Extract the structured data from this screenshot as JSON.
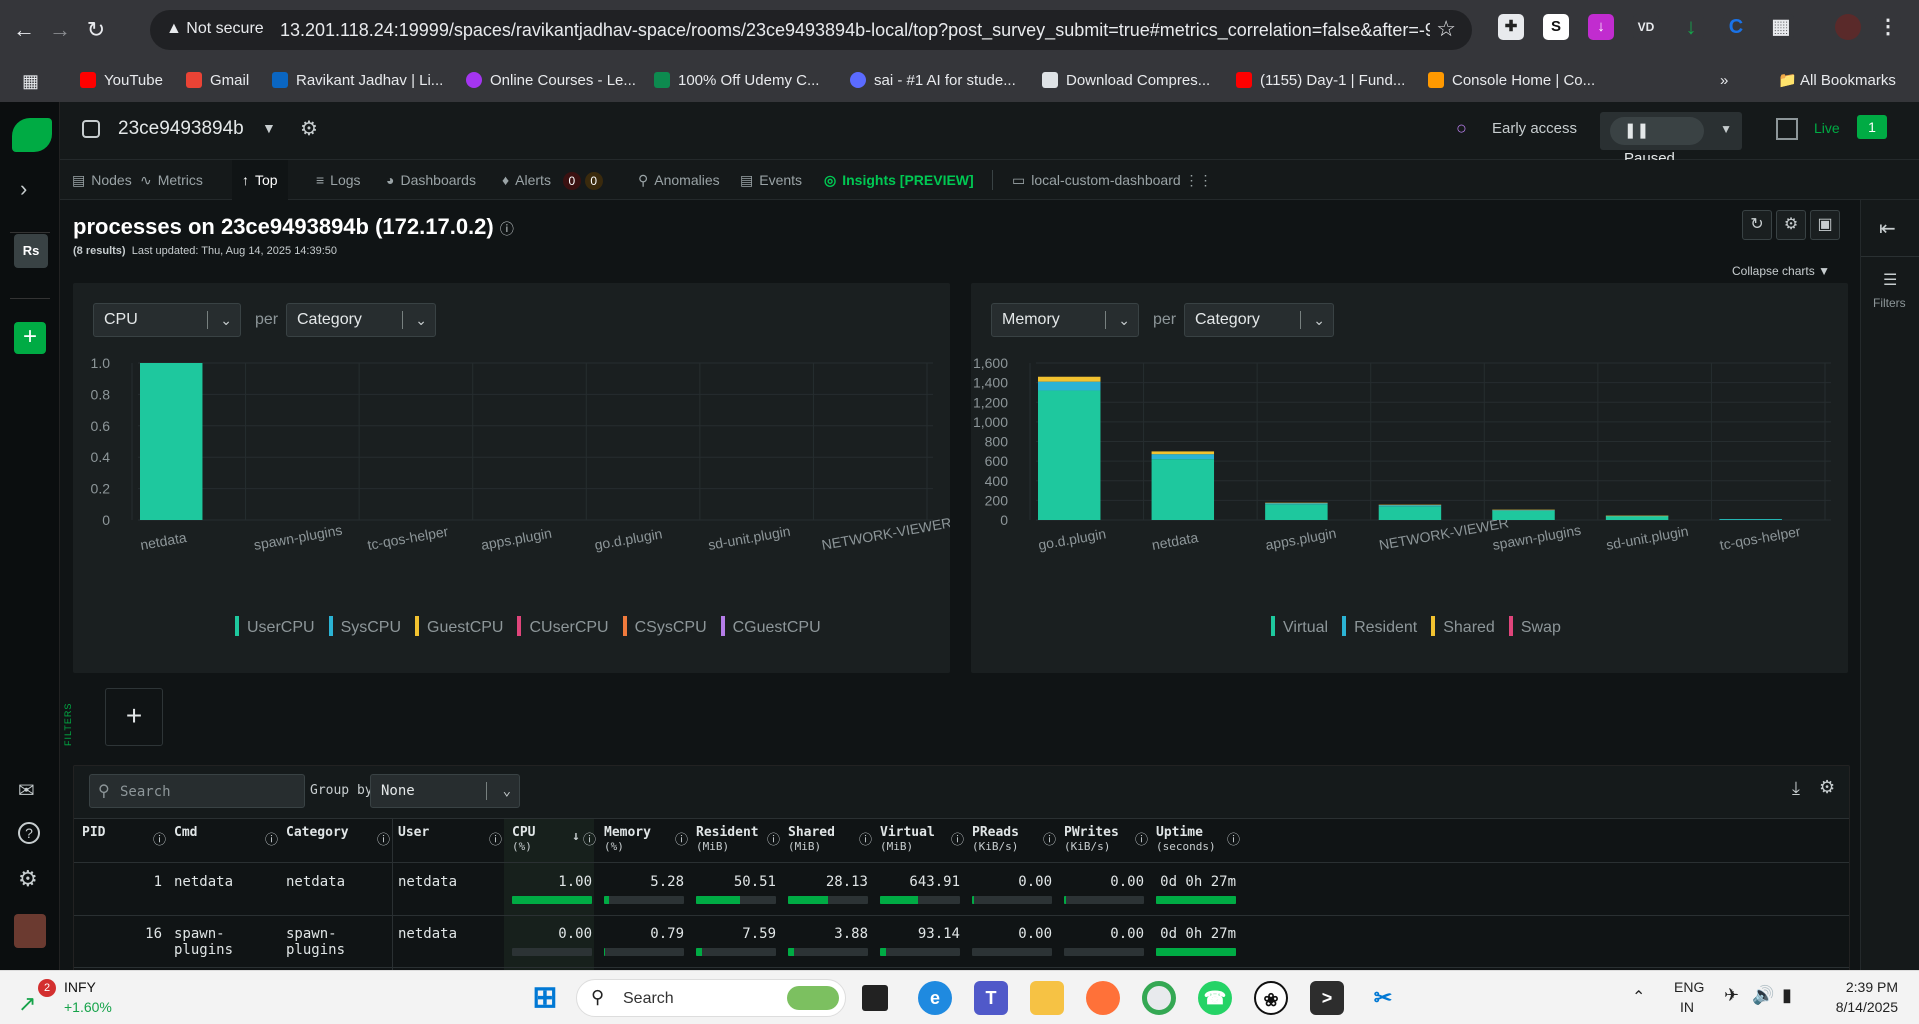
{
  "browser": {
    "not_secure": "Not secure",
    "url": "13.201.118.24:19999/spaces/ravikantjadhav-space/rooms/23ce9493894b-local/top?post_survey_submit=true#metrics_correlation=false&after=-90...",
    "bookmarks": [
      "YouTube",
      "Gmail",
      "Ravikant Jadhav | Li...",
      "Online Courses - Le...",
      "100% Off Udemy C...",
      "sai - #1 AI for stude...",
      "Download Compres...",
      "(1155) Day-1 | Fund...",
      "Console Home | Co..."
    ],
    "all_bookmarks": "All Bookmarks",
    "ext_letters": [
      "S",
      "VD"
    ]
  },
  "app": {
    "room_name": "23ce9493894b",
    "early_access": "Early access",
    "paused": "Paused",
    "live": "Live",
    "live_count": "1",
    "rail_badge": "Rs",
    "tabs": [
      "Nodes",
      "Metrics",
      "Top",
      "Logs",
      "Dashboards",
      "Alerts",
      "Anomalies",
      "Events",
      "Insights [PREVIEW]",
      "local-custom-dashboard"
    ],
    "alert_counts": [
      "0",
      "0"
    ],
    "filters_label": "Filters",
    "filters_side": "FILTERS"
  },
  "header": {
    "title": "processes on 23ce9493894b (172.17.0.2)",
    "results": "(8 results)",
    "updated": "Last updated: Thu, Aug 14, 2025 14:39:50",
    "collapse": "Collapse charts"
  },
  "cpu_panel": {
    "metric": "CPU",
    "per": "per",
    "group": "Category"
  },
  "mem_panel": {
    "metric": "Memory",
    "per": "per",
    "group": "Category"
  },
  "chart_data": [
    {
      "type": "bar",
      "categories": [
        "netdata",
        "spawn-plugins",
        "tc-qos-helper",
        "apps.plugin",
        "go.d.plugin",
        "sd-unit.plugin",
        "NETWORK-VIEWER"
      ],
      "series": [
        {
          "name": "UserCPU",
          "values": [
            1.0,
            0,
            0,
            0,
            0,
            0,
            0
          ]
        },
        {
          "name": "SysCPU",
          "values": [
            0,
            0,
            0,
            0,
            0,
            0,
            0
          ]
        },
        {
          "name": "GuestCPU",
          "values": [
            0,
            0,
            0,
            0,
            0,
            0,
            0
          ]
        },
        {
          "name": "CUserCPU",
          "values": [
            0,
            0,
            0,
            0,
            0,
            0,
            0
          ]
        },
        {
          "name": "CSysCPU",
          "values": [
            0,
            0,
            0,
            0,
            0,
            0,
            0
          ]
        },
        {
          "name": "CGuestCPU",
          "values": [
            0,
            0,
            0,
            0,
            0,
            0,
            0
          ]
        }
      ],
      "colors": [
        "#1ec89e",
        "#2bb3d4",
        "#f2c230",
        "#e0457b",
        "#f07a3c",
        "#b57de8"
      ],
      "ylim": [
        0,
        1.0
      ],
      "yticks": [
        "0",
        "0.2",
        "0.4",
        "0.6",
        "0.8",
        "1.0"
      ]
    },
    {
      "type": "bar",
      "categories": [
        "go.d.plugin",
        "netdata",
        "apps.plugin",
        "NETWORK-VIEWER",
        "spawn-plugins",
        "sd-unit.plugin",
        "tc-qos-helper"
      ],
      "series": [
        {
          "name": "Virtual",
          "values": [
            1320,
            620,
            160,
            140,
            95,
            40,
            8
          ]
        },
        {
          "name": "Resident",
          "values": [
            90,
            51,
            12,
            12,
            8,
            3,
            1
          ]
        },
        {
          "name": "Shared",
          "values": [
            50,
            28,
            4,
            4,
            2,
            1,
            0
          ]
        },
        {
          "name": "Swap",
          "values": [
            0,
            0,
            0,
            0,
            0,
            0,
            0
          ]
        }
      ],
      "colors": [
        "#1ec89e",
        "#2bb3d4",
        "#f2c230",
        "#e0457b"
      ],
      "ylim": [
        0,
        1600
      ],
      "yticks": [
        "0",
        "200",
        "400",
        "600",
        "800",
        "1,000",
        "1,200",
        "1,400",
        "1,600"
      ]
    }
  ],
  "table": {
    "search_placeholder": "Search",
    "group_by": "Group by",
    "group_value": "None",
    "columns": [
      {
        "name": "PID",
        "sub": ""
      },
      {
        "name": "Cmd",
        "sub": ""
      },
      {
        "name": "Category",
        "sub": ""
      },
      {
        "name": "User",
        "sub": ""
      },
      {
        "name": "CPU",
        "sub": "(%)"
      },
      {
        "name": "Memory",
        "sub": "(%)"
      },
      {
        "name": "Resident",
        "sub": "(MiB)"
      },
      {
        "name": "Shared",
        "sub": "(MiB)"
      },
      {
        "name": "Virtual",
        "sub": "(MiB)"
      },
      {
        "name": "PReads",
        "sub": "(KiB/s)"
      },
      {
        "name": "PWrites",
        "sub": "(KiB/s)"
      },
      {
        "name": "Uptime",
        "sub": "(seconds)"
      }
    ],
    "rows": [
      {
        "pid": "1",
        "cmd": "netdata",
        "category": "netdata",
        "user": "netdata",
        "cpu": "1.00",
        "memory": "5.28",
        "resident": "50.51",
        "shared": "28.13",
        "virtual": "643.91",
        "preads": "0.00",
        "pwrites": "0.00",
        "uptime": "0d 0h 27m",
        "bars": [
          1.0,
          0.06,
          0.55,
          0.5,
          0.48,
          0.02,
          0.02,
          1.0
        ]
      },
      {
        "pid": "16",
        "cmd": "spawn-plugins",
        "category": "spawn-plugins",
        "user": "netdata",
        "cpu": "0.00",
        "memory": "0.79",
        "resident": "7.59",
        "shared": "3.88",
        "virtual": "93.14",
        "preads": "0.00",
        "pwrites": "0.00",
        "uptime": "0d 0h 27m",
        "bars": [
          0.0,
          0.01,
          0.08,
          0.07,
          0.07,
          0.0,
          0.0,
          1.0
        ]
      }
    ]
  },
  "taskbar": {
    "stock_name": "INFY",
    "stock_change": "+1.60%",
    "stock_badge": "2",
    "search": "Search",
    "lang1": "ENG",
    "lang2": "IN",
    "time": "2:39 PM",
    "date": "8/14/2025"
  }
}
